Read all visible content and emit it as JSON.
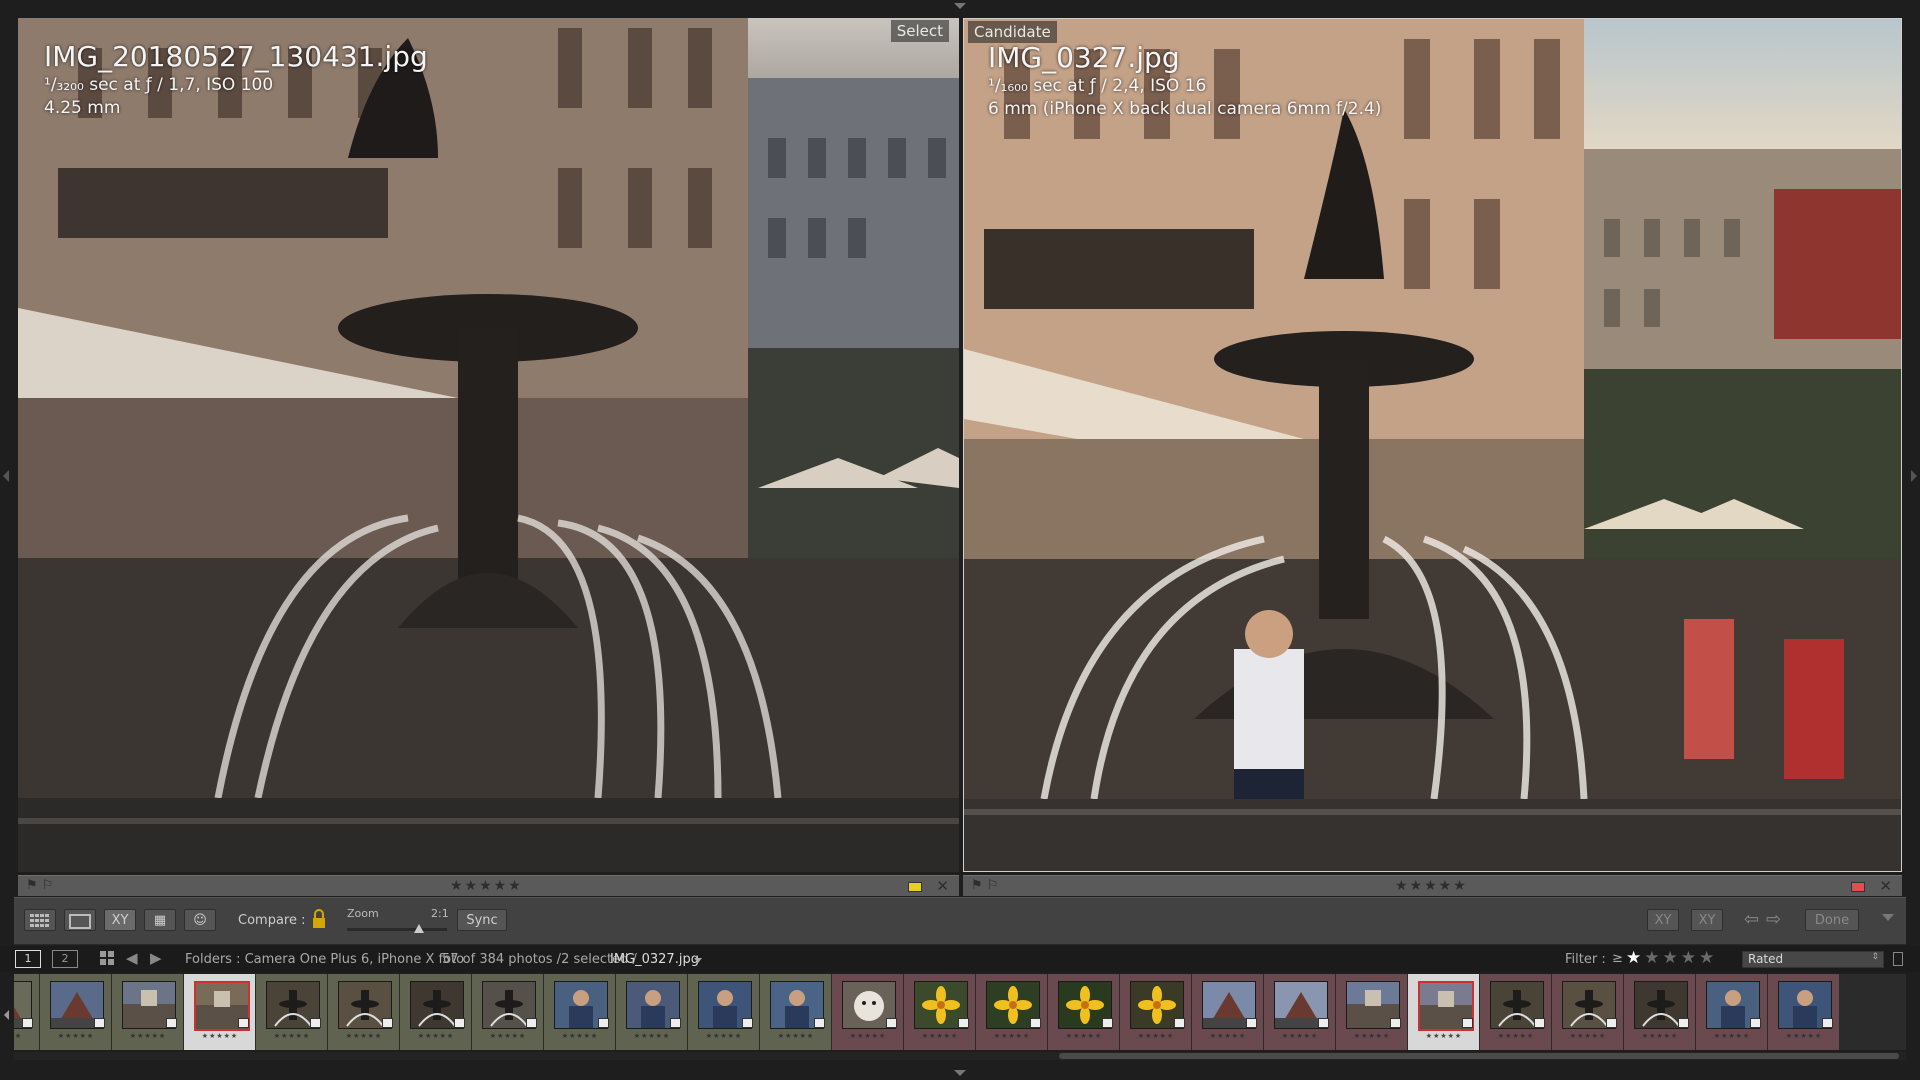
{
  "left_panel": {
    "tag": "Select",
    "filename": "IMG_20180527_130431.jpg",
    "exposure": "¹/₃₂₀₀ sec at ƒ / 1,7, ISO 100",
    "focal": "4.25 mm",
    "stars": "★★★★★"
  },
  "right_panel": {
    "tag": "Candidate",
    "filename": "IMG_0327.jpg",
    "exposure": "¹/₁₆₀₀ sec at ƒ / 2,4, ISO 16",
    "focal": "6 mm (iPhone X back dual camera 6mm f/2.4)",
    "stars": "★★★★★",
    "label_color": "#e05050"
  },
  "toolbar": {
    "compare_label": "Compare :",
    "zoom_label": "Zoom",
    "zoom_value": "2:1",
    "zoom_level": 0.72,
    "sync_label": "Sync",
    "xy_label": "XY",
    "done_label": "Done"
  },
  "filmstrip_header": {
    "monitor1": "1",
    "monitor2": "2",
    "folder_text": "Folders : Camera One Plus 6, iPhone X foto",
    "count_text": "57 of 384 photos /2 selected /",
    "current_file": "IMG_0327.jpg",
    "filter_label": "Filter :",
    "filter_op": "≥",
    "filter_stars": "★★★★★",
    "filter_rating": 1,
    "filter_value": "Rated"
  },
  "filmstrip": {
    "stars": "★★★★★",
    "thumbs": [
      {
        "scene": "building",
        "bg": "#6a6a5a",
        "group": "green",
        "state": "normal"
      },
      {
        "scene": "building",
        "bg": "#5a6a8a",
        "group": "green",
        "state": "normal"
      },
      {
        "scene": "street",
        "bg": "#6c7488",
        "group": "green",
        "state": "normal"
      },
      {
        "scene": "street",
        "bg": "#7a6a58",
        "group": "green",
        "state": "selected"
      },
      {
        "scene": "fountain",
        "bg": "#4a4438",
        "group": "green",
        "state": "normal"
      },
      {
        "scene": "fountain",
        "bg": "#5a5042",
        "group": "green",
        "state": "normal"
      },
      {
        "scene": "fountain",
        "bg": "#3e3830",
        "group": "green",
        "state": "normal"
      },
      {
        "scene": "fountain",
        "bg": "#55504a",
        "group": "green",
        "state": "normal"
      },
      {
        "scene": "portrait",
        "bg": "#4a6080",
        "group": "green",
        "state": "normal"
      },
      {
        "scene": "portrait",
        "bg": "#4a5a78",
        "group": "green",
        "state": "normal"
      },
      {
        "scene": "portrait",
        "bg": "#3e5478",
        "group": "green",
        "state": "normal"
      },
      {
        "scene": "portrait",
        "bg": "#4a6488",
        "group": "green",
        "state": "normal"
      },
      {
        "scene": "dog",
        "bg": "#6a6258",
        "group": "red",
        "state": "normal"
      },
      {
        "scene": "flower",
        "bg": "#3a4a2a",
        "group": "red",
        "state": "normal"
      },
      {
        "scene": "flower",
        "bg": "#2e3e22",
        "group": "red",
        "state": "normal"
      },
      {
        "scene": "flower",
        "bg": "#2a3a1e",
        "group": "red",
        "state": "normal"
      },
      {
        "scene": "flower",
        "bg": "#3a3a26",
        "group": "red",
        "state": "normal"
      },
      {
        "scene": "building",
        "bg": "#7a8aa8",
        "group": "red",
        "state": "normal"
      },
      {
        "scene": "building",
        "bg": "#8a96b0",
        "group": "red",
        "state": "normal"
      },
      {
        "scene": "street",
        "bg": "#6c7a98",
        "group": "red",
        "state": "normal"
      },
      {
        "scene": "street",
        "bg": "#7a7a90",
        "group": "red",
        "state": "selected"
      },
      {
        "scene": "fountain",
        "bg": "#4a4438",
        "group": "red",
        "state": "normal"
      },
      {
        "scene": "fountain",
        "bg": "#5a5042",
        "group": "red",
        "state": "normal"
      },
      {
        "scene": "fountain",
        "bg": "#3e3830",
        "group": "red",
        "state": "normal"
      },
      {
        "scene": "portrait",
        "bg": "#4a6080",
        "group": "red",
        "state": "normal"
      },
      {
        "scene": "portrait",
        "bg": "#3e5478",
        "group": "red",
        "state": "normal"
      }
    ]
  },
  "colors": {
    "green_group": "#5f6350",
    "red_group": "#6a4a4e",
    "selected_cell": "#d8d8d8",
    "yellow_label": "#e8d020"
  },
  "icons": {
    "grid": "grid-view-icon",
    "loupe": "loupe-view-icon",
    "compare": "compare-view-icon",
    "survey": "survey-view-icon",
    "people": "people-view-icon",
    "lock": "lock-icon"
  }
}
